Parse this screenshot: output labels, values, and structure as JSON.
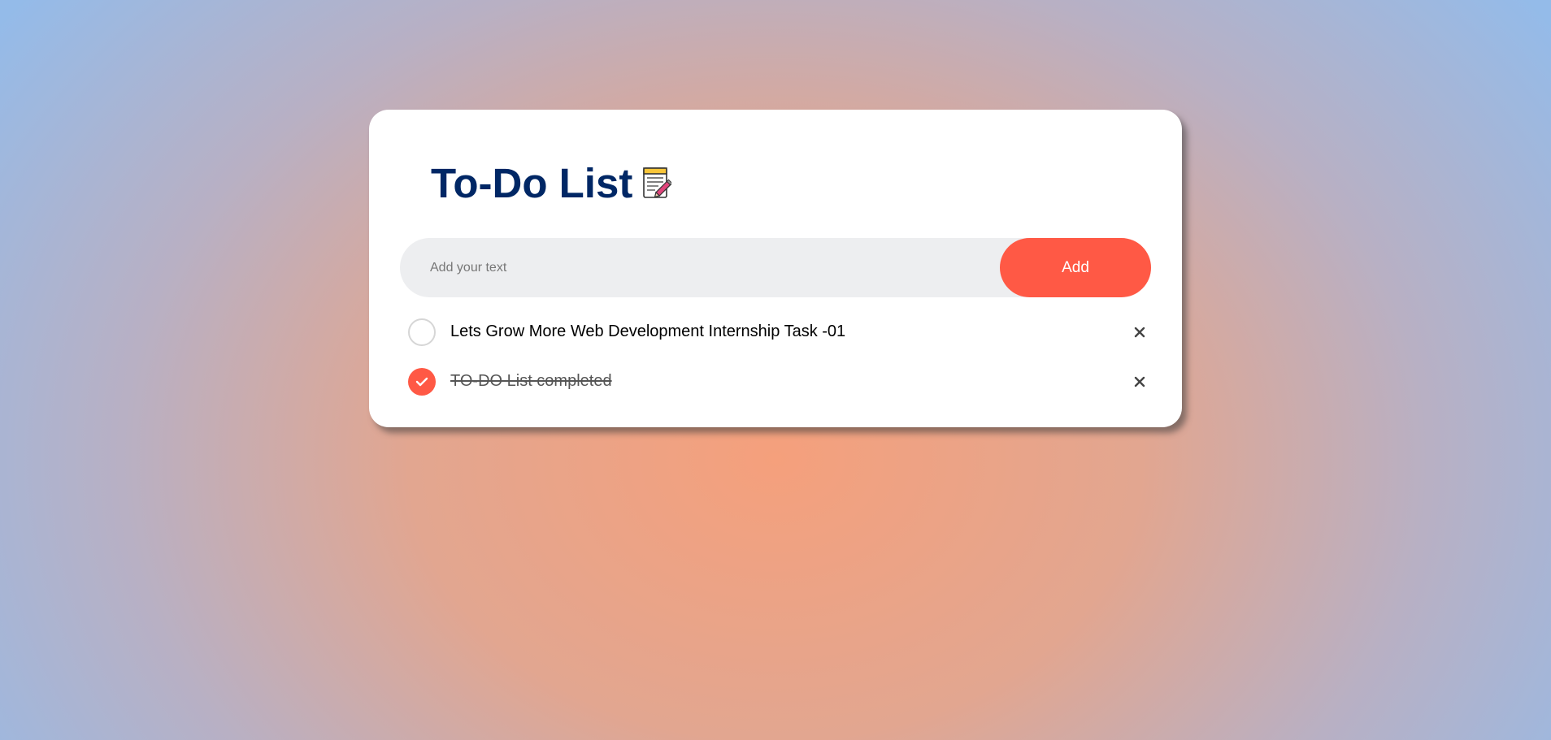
{
  "header": {
    "title": "To-Do List",
    "icon": "notepad-icon"
  },
  "input": {
    "placeholder": "Add your text",
    "value": ""
  },
  "add_button": {
    "label": "Add"
  },
  "tasks": [
    {
      "text": "Lets Grow More Web Development Internship Task -01",
      "checked": false
    },
    {
      "text": "TO-DO List completed",
      "checked": true
    }
  ],
  "colors": {
    "accent": "#ff5945",
    "title": "#002765",
    "input_bg": "#edeef0",
    "card": "#ffffff"
  }
}
